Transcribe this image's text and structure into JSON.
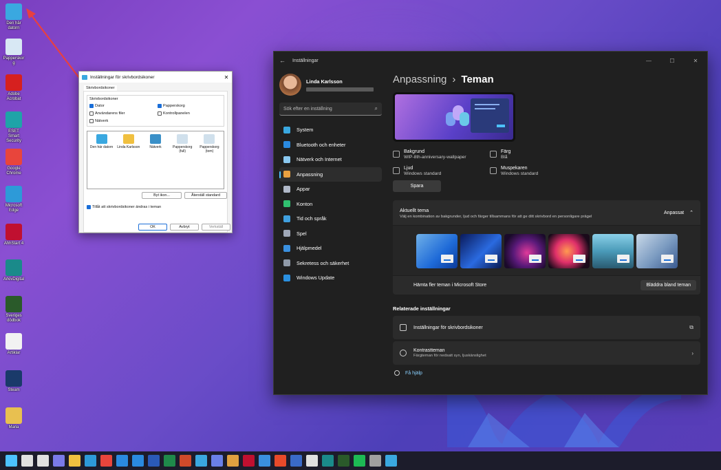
{
  "desktop": {
    "icons": [
      {
        "label": "Den här datorn",
        "icon": "computer-icon",
        "color": "#3aa8e0"
      },
      {
        "label": "Papperskorg",
        "icon": "recycle-bin-icon",
        "color": "#d8e8f4"
      },
      {
        "label": "Adobe Acrobat",
        "icon": "acrobat-icon",
        "color": "#d6201f"
      },
      {
        "label": "ESET Smart Security",
        "icon": "eset-icon",
        "color": "#1fa3a8"
      },
      {
        "label": "Google Chrome",
        "icon": "chrome-icon",
        "color": "#e8453c"
      },
      {
        "label": "Microsoft Edge",
        "icon": "edge-icon",
        "color": "#2d9ad8"
      },
      {
        "label": "AhhStart 4",
        "icon": "ahh-icon",
        "color": "#c01030"
      },
      {
        "label": "ArkivDigital",
        "icon": "arkivdigital-icon",
        "color": "#1a8a8a"
      },
      {
        "label": "Sveriges dödbok",
        "icon": "dodbok-icon",
        "color": "#2a5a2a"
      },
      {
        "label": "Artiklar",
        "icon": "document-icon",
        "color": "#f2f2f2"
      },
      {
        "label": "Steam",
        "icon": "steam-icon",
        "color": "#1a3a6a"
      },
      {
        "label": "Maria",
        "icon": "folder-icon",
        "color": "#e8c050"
      }
    ]
  },
  "dialog": {
    "title": "Inställningar för skrivbordsikoner",
    "tab": "Skrivbordsikoner",
    "group_label": "Skrivbordsikoner",
    "checkboxes": [
      {
        "label": "Dator",
        "checked": true
      },
      {
        "label": "Papperskorg",
        "checked": true
      },
      {
        "label": "Användarens filer",
        "checked": false
      },
      {
        "label": "Kontrollpanelen",
        "checked": false
      },
      {
        "label": "Nätverk",
        "checked": false
      }
    ],
    "icons": [
      {
        "label": "Den här datorn",
        "color": "#3aa8e0"
      },
      {
        "label": "Linda Karlsson",
        "color": "#f0c040"
      },
      {
        "label": "Nätverk",
        "color": "#3a90c8"
      },
      {
        "label": "Papperskorg (full)",
        "color": "#d0e0ec"
      },
      {
        "label": "Papperskorg (tom)",
        "color": "#d0e0ec"
      }
    ],
    "change_icon": "Byt ikon...",
    "restore_default": "Återställ standard",
    "allow_themes": "Tillåt att skrivbordsikoner ändras i teman",
    "ok": "OK",
    "cancel": "Avbryt",
    "apply": "Verkställ"
  },
  "settings": {
    "window_title": "Inställningar",
    "user_name": "Linda Karlsson",
    "search_placeholder": "Sök efter en inställning",
    "nav": [
      {
        "label": "System",
        "icon": "system-icon",
        "color": "#3aa8e0",
        "selected": false
      },
      {
        "label": "Bluetooth och enheter",
        "icon": "bluetooth-icon",
        "color": "#2a8ae0",
        "selected": false
      },
      {
        "label": "Nätverk och Internet",
        "icon": "wifi-icon",
        "color": "#8ac8f0",
        "selected": false
      },
      {
        "label": "Anpassning",
        "icon": "brush-icon",
        "color": "#e8a040",
        "selected": true
      },
      {
        "label": "Appar",
        "icon": "apps-icon",
        "color": "#b0b8c8",
        "selected": false
      },
      {
        "label": "Konton",
        "icon": "accounts-icon",
        "color": "#30c070",
        "selected": false
      },
      {
        "label": "Tid och språk",
        "icon": "globe-clock-icon",
        "color": "#40a0e0",
        "selected": false
      },
      {
        "label": "Spel",
        "icon": "gaming-icon",
        "color": "#a0a8b8",
        "selected": false
      },
      {
        "label": "Hjälpmedel",
        "icon": "accessibility-icon",
        "color": "#3a90e0",
        "selected": false
      },
      {
        "label": "Sekretess och säkerhet",
        "icon": "shield-icon",
        "color": "#909aa8",
        "selected": false
      },
      {
        "label": "Windows Update",
        "icon": "update-icon",
        "color": "#2a90e0",
        "selected": false
      }
    ],
    "breadcrumb_parent": "Anpassning",
    "breadcrumb_sep": "›",
    "breadcrumb_current": "Teman",
    "props": [
      {
        "title": "Bakgrund",
        "value": "WIP-8th-anniversary-wallpaper",
        "icon": "image-icon"
      },
      {
        "title": "Färg",
        "value": "Blå",
        "icon": "palette-icon"
      },
      {
        "title": "Ljud",
        "value": "Windows standard",
        "icon": "speaker-icon"
      },
      {
        "title": "Muspekaren",
        "value": "Windows standard",
        "icon": "pointer-icon"
      }
    ],
    "save": "Spara",
    "current_theme": {
      "title": "Aktuellt tema",
      "desc": "Välj en kombination av bakgrunder, ljud och färger tillsammans för att ge ditt skrivbord en personligare prägel",
      "value": "Anpassat"
    },
    "themes": [
      {
        "bg": "linear-gradient(135deg,#6fb0e8,#1e6ad8 60%,#0c3a98)"
      },
      {
        "bg": "linear-gradient(135deg,#0a1a5a,#2a6ae0 55%,#0a1a50)"
      },
      {
        "bg": "radial-gradient(circle at 55% 55%,#e03a9a,#5a1a7a 45%,#1a0a2a 80%)"
      },
      {
        "bg": "radial-gradient(circle at 45% 50%,#ff9a50,#e0306a 40%,#1a0a1a 80%)"
      },
      {
        "bg": "linear-gradient(180deg,#8ad0e8,#4a9ab8 50%,#2a5a70)"
      },
      {
        "bg": "linear-gradient(135deg,#c8d8e8,#7a9ac0 55%,#3a5a90)"
      }
    ],
    "store_text": "Hämta fler teman i Microsoft Store",
    "browse": "Bläddra bland teman",
    "related_header": "Relaterade inställningar",
    "related": [
      {
        "title": "Inställningar för skrivbordsikoner",
        "subtitle": "",
        "icon": "monitor-icon",
        "action": "open-external-icon"
      },
      {
        "title": "Kontrastteman",
        "subtitle": "Färgteman för nedsatt syn, ljuskänslighet",
        "icon": "contrast-icon",
        "action": "chevron-right-icon"
      }
    ],
    "help": "Få hjälp"
  },
  "taskbar": {
    "items": [
      {
        "icon": "start-icon",
        "color": "#4cc2ff"
      },
      {
        "icon": "search-icon",
        "color": "#e0e0e0"
      },
      {
        "icon": "task-view-icon",
        "color": "#e0e0e0"
      },
      {
        "icon": "chat-icon",
        "color": "#7a7ae8"
      },
      {
        "icon": "file-explorer-icon",
        "color": "#f0c040"
      },
      {
        "icon": "edge-icon",
        "color": "#2d9ad8"
      },
      {
        "icon": "chrome-icon",
        "color": "#e8453c"
      },
      {
        "icon": "mail-icon",
        "color": "#2a8ae0"
      },
      {
        "icon": "calendar-icon",
        "color": "#2a8ae0"
      },
      {
        "icon": "word-icon",
        "color": "#2a5ab8"
      },
      {
        "icon": "excel-icon",
        "color": "#1f8a4a"
      },
      {
        "icon": "powerpoint-icon",
        "color": "#d04a2a"
      },
      {
        "icon": "photos-icon",
        "color": "#3aa8e0"
      },
      {
        "icon": "snipping-icon",
        "color": "#6a80e8"
      },
      {
        "icon": "paint-icon",
        "color": "#e0a040"
      },
      {
        "icon": "ahh-icon",
        "color": "#c01030"
      },
      {
        "icon": "photo-viewer-icon",
        "color": "#3a90e0"
      },
      {
        "icon": "office-icon",
        "color": "#e84a2a"
      },
      {
        "icon": "app-s-icon",
        "color": "#3a6ac8"
      },
      {
        "icon": "app-arrow-icon",
        "color": "#e0e0e0"
      },
      {
        "icon": "arkivdigital-icon",
        "color": "#1a8a8a"
      },
      {
        "icon": "dodbok-icon",
        "color": "#2a5a2a"
      },
      {
        "icon": "spotify-icon",
        "color": "#1db954"
      },
      {
        "icon": "settings-icon",
        "color": "#a0a0a0"
      },
      {
        "icon": "desktop-icon-settings-icon",
        "color": "#3aa8e0"
      }
    ]
  }
}
